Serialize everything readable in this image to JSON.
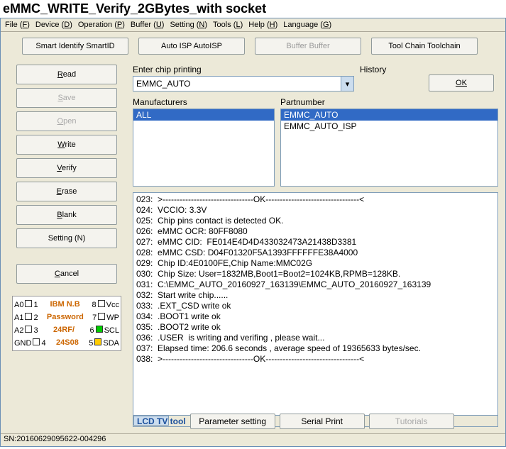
{
  "title": "eMMC_WRITE_Verify_2GBytes_with socket",
  "menu": [
    {
      "label": "File",
      "key": "F"
    },
    {
      "label": "Device",
      "key": "D"
    },
    {
      "label": "Operation",
      "key": "P"
    },
    {
      "label": "Buffer",
      "key": "U"
    },
    {
      "label": "Setting",
      "key": "N"
    },
    {
      "label": "Tools",
      "key": "L"
    },
    {
      "label": "Help",
      "key": "H"
    },
    {
      "label": "Language",
      "key": "G"
    }
  ],
  "toolbar": {
    "smart": "Smart Identify SmartID",
    "auto": "Auto ISP AutoISP",
    "buffer": "Buffer Buffer",
    "toolchain": "Tool Chain Toolchain"
  },
  "left": {
    "read": "Read",
    "save": "Save",
    "open": "Open",
    "write": "Write",
    "verify": "Verify",
    "erase": "Erase",
    "blank": "Blank",
    "setting": "Setting (N)",
    "cancel": "Cancel"
  },
  "chip": {
    "l1": "IBM N.B",
    "l2": "Password",
    "l3": "24RF/",
    "l4": "24S08",
    "A0": "A0",
    "A1": "A1",
    "A2": "A2",
    "GND": "GND",
    "Vcc": "Vcc",
    "WP": "WP",
    "SCL": "SCL",
    "SDA": "SDA",
    "p1": "1",
    "p2": "2",
    "p3": "3",
    "p4": "4",
    "p5": "5",
    "p6": "6",
    "p7": "7",
    "p8": "8"
  },
  "search": {
    "enter_label": "Enter chip printing",
    "history_label": "History",
    "value": "EMMC_AUTO",
    "ok": "OK"
  },
  "lists": {
    "mfg_label": "Manufacturers",
    "mfg": [
      {
        "t": "ALL",
        "sel": true
      }
    ],
    "part_label": "Partnumber",
    "part": [
      {
        "t": "EMMC_AUTO",
        "sel": true
      },
      {
        "t": "EMMC_AUTO_ISP",
        "sel": false
      }
    ]
  },
  "log": "023:  >--------------------------------OK---------------------------------<\n024:  VCCIO: 3.3V\n025:  Chip pins contact is detected OK.\n026:  eMMC OCR: 80FF8080\n027:  eMMC CID:  FE014E4D4D433032473A21438D3381\n028:  eMMC CSD: D04F01320F5A1393FFFFFFE38A4000\n029:  Chip ID:4E0100FE,Chip Name:MMC02G\n030:  Chip Size: User=1832MB,Boot1=Boot2=1024KB,RPMB=128KB.\n031:  C:\\EMMC_AUTO_20160927_163139\\EMMC_AUTO_20160927_163139\n032:  Start write chip......\n033:  .EXT_CSD write ok\n034:  .BOOT1 write ok\n035:  .BOOT2 write ok\n036:  .USER  is writing and verifing , please wait...\n037:  Elapsed time: 206.6 seconds , average speed of 19365633 bytes/sec.\n038:  >--------------------------------OK---------------------------------<",
  "bottom": {
    "lcd": "LCD TV tool",
    "param": "Parameter setting",
    "serial": "Serial Print",
    "tut": "Tutorials"
  },
  "status": "SN:20160629095622-004296"
}
